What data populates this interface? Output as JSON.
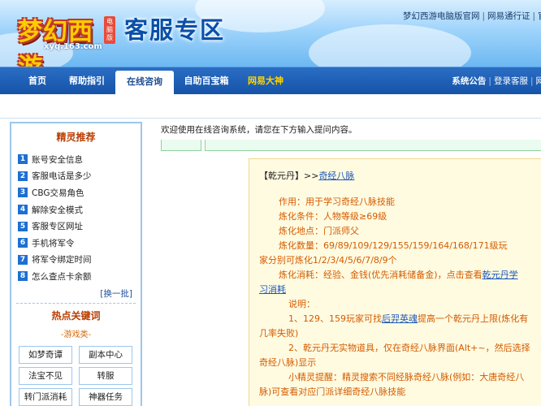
{
  "header": {
    "logo_text": "梦幻西游",
    "logo_badge": "电脑版",
    "logo_url": "xyq.163.com",
    "title": "客服专区",
    "top_links": [
      "梦幻西游电脑版官网",
      "网易通行证",
      "官方"
    ]
  },
  "nav": {
    "items": [
      "首页",
      "帮助指引",
      "在线咨询",
      "自助百宝箱",
      "网易大神"
    ],
    "active": "在线咨询",
    "right_links": [
      "系统公告",
      "登录客服",
      "网"
    ]
  },
  "sidebar": {
    "title": "精灵推荐",
    "items": [
      {
        "num": "1",
        "label": "账号安全信息"
      },
      {
        "num": "2",
        "label": "客服电话是多少"
      },
      {
        "num": "3",
        "label": "CBG交易角色"
      },
      {
        "num": "4",
        "label": "解除安全模式"
      },
      {
        "num": "5",
        "label": "客服专区网址"
      },
      {
        "num": "6",
        "label": "手机将军令"
      },
      {
        "num": "7",
        "label": "将军令绑定时间"
      },
      {
        "num": "8",
        "label": "怎么查点卡余额"
      }
    ],
    "refresh_label": "[换一批]",
    "hot_title": "热点关键词",
    "category_label": "-游戏类-",
    "keywords": [
      "如梦奇谭",
      "副本中心",
      "法宝不见",
      "转服",
      "转门派消耗",
      "神器任务"
    ]
  },
  "main": {
    "welcome": "欢迎使用在线咨询系统，请您在下方输入提问内容。",
    "answer": {
      "head_prefix": "【乾元丹】>>",
      "head_link": "奇经八脉",
      "lines": [
        "作用：用于学习奇经八脉技能",
        "炼化条件：人物等级≥69级",
        "炼化地点：门派师父",
        "炼化数量：69/89/109/129/155/159/164/168/171级玩",
        "家分别可炼化1/2/3/4/5/6/7/8/9个"
      ],
      "consume_prefix": "炼化消耗：经验、金钱(优先消耗储备金)，点击查看",
      "consume_link": "乾元丹学",
      "consume_link_2": "习消耗",
      "notes_title": "说明：",
      "note1_a": "1、129、159玩家可找",
      "note1_link": "后羿英魂",
      "note1_b": "提高一个乾元丹上限(炼化有",
      "note1_c": "几率失败)",
      "note2_a": "2、乾元丹无实物道具，仅在奇经八脉界面(Alt+~，然后选择",
      "note2_b": "奇经八脉)显示",
      "tip_a": "小精灵提醒：精灵搜索不同经脉奇经八脉(例如：大唐奇经八",
      "tip_b": "脉)可查看对应门派详细奇经八脉技能"
    }
  },
  "colors": {
    "nav_bg": "#1553a8",
    "accent_orange": "#d45b00",
    "link_blue": "#1b56b8",
    "answer_bg": "#fffbe1",
    "sidebar_border": "#9cc7ee"
  }
}
